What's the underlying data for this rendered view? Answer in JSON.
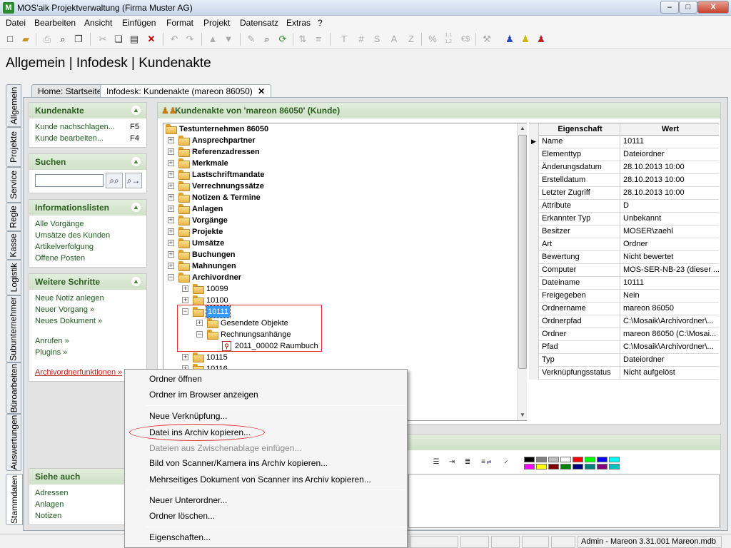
{
  "window": {
    "title": "MOS'aik Projektverwaltung (Firma Muster AG)",
    "controls": {
      "minimize": "–",
      "maximize": "□",
      "close": "X"
    }
  },
  "menu": [
    "Datei",
    "Bearbeiten",
    "Ansicht",
    "Einfügen",
    "Format",
    "Projekt",
    "Datensatz",
    "Extras",
    "?"
  ],
  "toolbar_text": {
    "t": "T",
    "hash": "#",
    "s": "S",
    "a": "A",
    "z": "Z",
    "percent": "%",
    "num": "1,1\n1,2",
    "euro": "€$"
  },
  "page_heading": "Allgemein | Infodesk | Kundenakte",
  "vertical_tabs": [
    "Allgemein",
    "Projekte",
    "Service",
    "Regie",
    "Kasse",
    "Logistik",
    "Subunternehmer",
    "Büroarbeiten",
    "Auswertungen",
    "Stammdaten"
  ],
  "doc_tabs": [
    {
      "label": "Home: Startseite"
    },
    {
      "label": "Infodesk: Kundenakte (mareon 86050)",
      "close": "✕"
    }
  ],
  "side": {
    "kundenakte": {
      "title": "Kundenakte",
      "links": [
        {
          "label": "Kunde nachschlagen...",
          "key": "F5"
        },
        {
          "label": "Kunde bearbeiten...",
          "key": "F4"
        }
      ]
    },
    "suchen": {
      "title": "Suchen"
    },
    "infolisten": {
      "title": "Informationslisten",
      "links": [
        "Alle Vorgänge",
        "Umsätze des Kunden",
        "Artikelverfolgung",
        "Offene Posten"
      ]
    },
    "weitere": {
      "title": "Weitere Schritte",
      "links": [
        "Neue Notiz anlegen",
        "Neuer Vorgang »",
        "Neues Dokument »",
        "Anrufen »",
        "Plugins »",
        "Archivordnerfunktionen »"
      ]
    },
    "siehe": {
      "title": "Siehe auch",
      "links": [
        "Adressen",
        "Anlagen",
        "Notizen"
      ]
    }
  },
  "akte": {
    "title": "Kundenakte von 'mareon 86050' (Kunde)"
  },
  "tree": {
    "root": "Testunternehmen 86050",
    "top": [
      "Ansprechpartner",
      "Referenzadressen",
      "Merkmale",
      "Lastschriftmandate",
      "Verrechnungssätze",
      "Notizen & Termine",
      "Anlagen",
      "Vorgänge",
      "Projekte",
      "Umsätze",
      "Buchungen",
      "Mahnungen",
      "Archivordner"
    ],
    "archiv": [
      "10099",
      "10100",
      "10111"
    ],
    "sub": [
      "Gesendete Objekte",
      "Rechnungsanhänge"
    ],
    "file": "2011_00002 Raumbuch",
    "after": [
      "10115",
      "10116"
    ]
  },
  "props": {
    "header": {
      "key": "Eigenschaft",
      "value": "Wert"
    },
    "rows": [
      {
        "k": "Name",
        "v": "10111"
      },
      {
        "k": "Elementtyp",
        "v": "Dateiordner"
      },
      {
        "k": "Änderungsdatum",
        "v": "28.10.2013 10:00"
      },
      {
        "k": "Erstelldatum",
        "v": "28.10.2013 10:00"
      },
      {
        "k": "Letzter Zugriff",
        "v": "28.10.2013 10:00"
      },
      {
        "k": "Attribute",
        "v": "D"
      },
      {
        "k": "Erkannter Typ",
        "v": "Unbekannt"
      },
      {
        "k": "Besitzer",
        "v": "MOSER\\zaehl"
      },
      {
        "k": "Art",
        "v": "Ordner"
      },
      {
        "k": "Bewertung",
        "v": "Nicht bewertet"
      },
      {
        "k": "Computer",
        "v": "MOS-SER-NB-23 (dieser ..."
      },
      {
        "k": "Dateiname",
        "v": "10111"
      },
      {
        "k": "Freigegeben",
        "v": "Nein"
      },
      {
        "k": "Ordnername",
        "v": "mareon 86050"
      },
      {
        "k": "Ordnerpfad",
        "v": "C:\\Mosaik\\Archivordner\\..."
      },
      {
        "k": "Ordner",
        "v": "mareon 86050 (C:\\Mosai..."
      },
      {
        "k": "Pfad",
        "v": "C:\\Mosaik\\Archivordner\\..."
      },
      {
        "k": "Typ",
        "v": "Dateiordner"
      },
      {
        "k": "Verknüpfungsstatus",
        "v": "Nicht aufgelöst"
      }
    ]
  },
  "context_menu": {
    "items": [
      {
        "label": "Ordner öffnen",
        "disabled": false
      },
      {
        "label": "Ordner im Browser anzeigen",
        "disabled": false
      },
      {
        "label": "Neue Verknüpfung...",
        "disabled": false
      },
      {
        "label": "Datei ins Archiv kopieren...",
        "disabled": false
      },
      {
        "label": "Dateien aus Zwischenablage einfügen...",
        "disabled": true
      },
      {
        "label": "Bild von Scanner/Kamera ins Archiv kopieren...",
        "disabled": false
      },
      {
        "label": "Mehrseitiges Dokument von Scanner ins Archiv kopieren...",
        "disabled": false
      },
      {
        "label": "Neuer Unterordner...",
        "disabled": false
      },
      {
        "label": "Ordner löschen...",
        "disabled": false
      },
      {
        "label": "Eigenschaften...",
        "disabled": false
      }
    ]
  },
  "colors": {
    "accent_green": "#2a5f1e",
    "selection": "#3399ff",
    "annotation_red": "#e03030"
  },
  "palette": [
    "#000000",
    "#808080",
    "#c0c0c0",
    "#ffffff",
    "#ff0000",
    "#00ff00",
    "#0000ff",
    "#00ffff",
    "#ff00ff",
    "#ffff00",
    "#800000",
    "#008000",
    "#000080",
    "#008080",
    "#800080",
    "#00c0c0"
  ],
  "status": {
    "user": "Admin - Mareon 3.31.001 Mareon.mdb"
  }
}
